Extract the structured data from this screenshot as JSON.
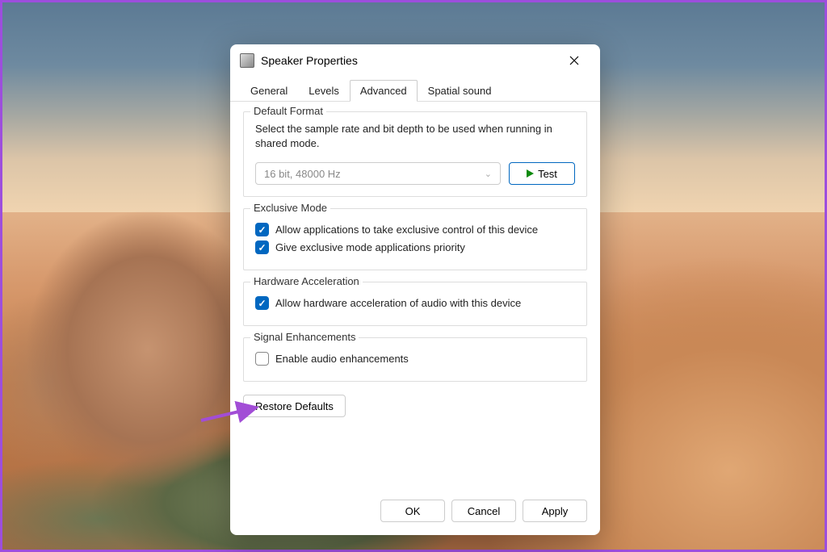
{
  "titlebar": {
    "title": "Speaker Properties"
  },
  "tabs": [
    {
      "label": "General",
      "active": false
    },
    {
      "label": "Levels",
      "active": false
    },
    {
      "label": "Advanced",
      "active": true
    },
    {
      "label": "Spatial sound",
      "active": false
    }
  ],
  "default_format": {
    "title": "Default Format",
    "desc": "Select the sample rate and bit depth to be used when running in shared mode.",
    "value": "16 bit, 48000 Hz",
    "test_label": "Test"
  },
  "exclusive_mode": {
    "title": "Exclusive Mode",
    "opt1": "Allow applications to take exclusive control of this device",
    "opt2": "Give exclusive mode applications priority",
    "opt1_checked": true,
    "opt2_checked": true
  },
  "hw_accel": {
    "title": "Hardware Acceleration",
    "opt": "Allow hardware acceleration of audio with this device",
    "checked": true
  },
  "signal_enh": {
    "title": "Signal Enhancements",
    "opt": "Enable audio enhancements",
    "checked": false
  },
  "buttons": {
    "restore": "Restore Defaults",
    "ok": "OK",
    "cancel": "Cancel",
    "apply": "Apply"
  }
}
